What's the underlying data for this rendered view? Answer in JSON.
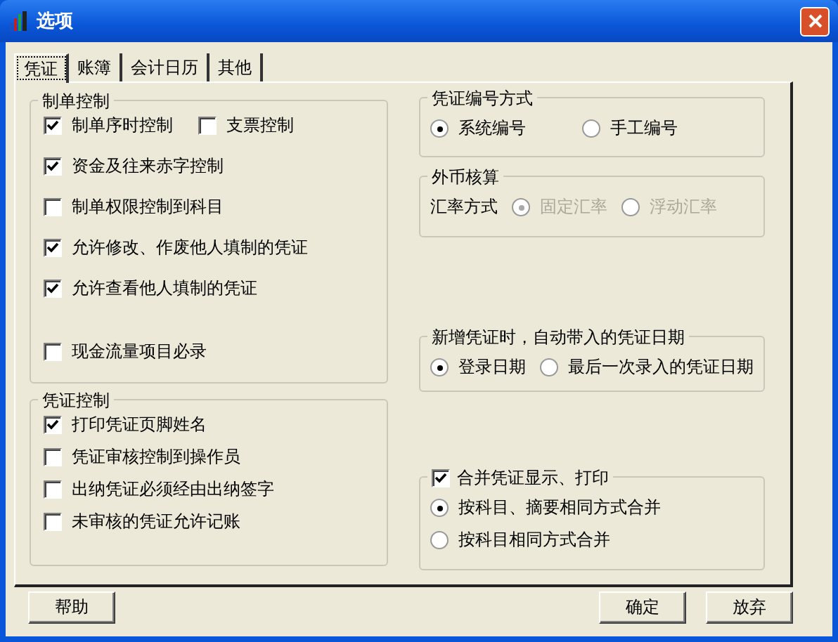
{
  "window": {
    "title": "选项"
  },
  "tabs": [
    {
      "label": "凭证",
      "selected": true
    },
    {
      "label": "账簿",
      "selected": false
    },
    {
      "label": "会计日历",
      "selected": false
    },
    {
      "label": "其他",
      "selected": false
    }
  ],
  "left_groups": [
    {
      "kind": "checkboxes",
      "title": "制单控制",
      "items": [
        {
          "label": "制单序时控制",
          "checked": true,
          "paired": {
            "label": "支票控制",
            "checked": false
          }
        },
        {
          "label": "资金及往来赤字控制",
          "checked": true
        },
        {
          "label": "制单权限控制到科目",
          "checked": false
        },
        {
          "label": "允许修改、作废他人填制的凭证",
          "checked": true
        },
        {
          "label": "允许查看他人填制的凭证",
          "checked": true
        },
        {
          "label": "现金流量项目必录",
          "checked": false
        }
      ]
    },
    {
      "kind": "checkboxes",
      "title": "凭证控制",
      "items": [
        {
          "label": "打印凭证页脚姓名",
          "checked": true
        },
        {
          "label": "凭证审核控制到操作员",
          "checked": false
        },
        {
          "label": "出纳凭证必须经由出纳签字",
          "checked": false
        },
        {
          "label": "未审核的凭证允许记账",
          "checked": false
        }
      ]
    }
  ],
  "right_groups": [
    {
      "kind": "radios",
      "title": "凭证编号方式",
      "options": [
        {
          "label": "系统编号",
          "selected": true,
          "disabled": false
        },
        {
          "label": "手工编号",
          "selected": false,
          "disabled": false
        }
      ]
    },
    {
      "kind": "labeled_radios",
      "title": "外币核算",
      "label": "汇率方式",
      "options": [
        {
          "label": "固定汇率",
          "selected": true,
          "disabled": true
        },
        {
          "label": "浮动汇率",
          "selected": false,
          "disabled": true
        }
      ]
    },
    {
      "kind": "radios",
      "title": "新增凭证时，自动带入的凭证日期",
      "options": [
        {
          "label": "登录日期",
          "selected": true,
          "disabled": false
        },
        {
          "label": "最后一次录入的凭证日期",
          "selected": false,
          "disabled": false
        }
      ]
    },
    {
      "kind": "check_radios",
      "title": "合并凭证显示、打印",
      "checked": true,
      "options": [
        {
          "label": "按科目、摘要相同方式合并",
          "selected": true,
          "disabled": false
        },
        {
          "label": "按科目相同方式合并",
          "selected": false,
          "disabled": false
        }
      ]
    }
  ],
  "buttons": [
    {
      "label": "帮助",
      "kind": "help"
    },
    {
      "label": "确定",
      "kind": "ok"
    },
    {
      "label": "放弃",
      "kind": "cancel"
    }
  ]
}
